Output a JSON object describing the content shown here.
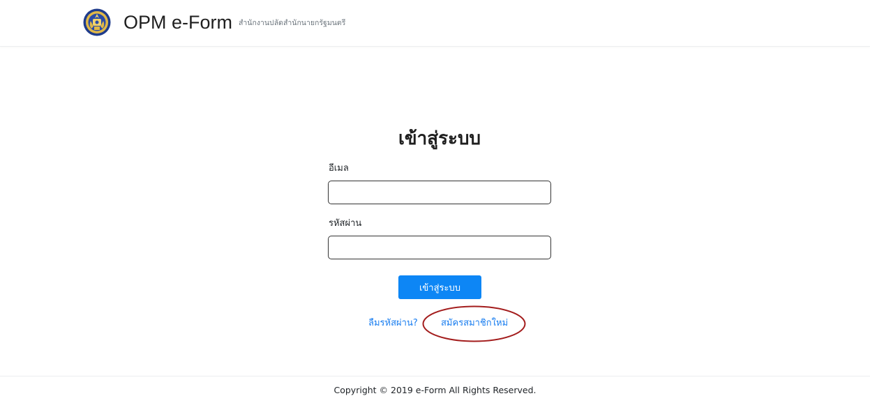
{
  "header": {
    "brand_name": "OPM e-Form",
    "subtitle": "สำนักงานปลัดสำนักนายกรัฐมนตรี",
    "logo_icon": "opm-emblem-icon"
  },
  "login": {
    "title": "เข้าสู่ระบบ",
    "email_label": "อีเมล",
    "email_value": "",
    "password_label": "รหัสผ่าน",
    "password_value": "",
    "submit_label": "เข้าสู่ระบบ",
    "forgot_password_link": "ลืมรหัสผ่าน?",
    "register_link": "สมัครสมาชิกใหม่"
  },
  "footer": {
    "copyright": "Copyright © 2019 e-Form All Rights Reserved."
  },
  "colors": {
    "primary_button": "#0d86f5",
    "link": "#1a7ef0",
    "annotation": "#a31c1c",
    "emblem_blue": "#1f3c8c",
    "emblem_gold": "#d4a83a"
  }
}
